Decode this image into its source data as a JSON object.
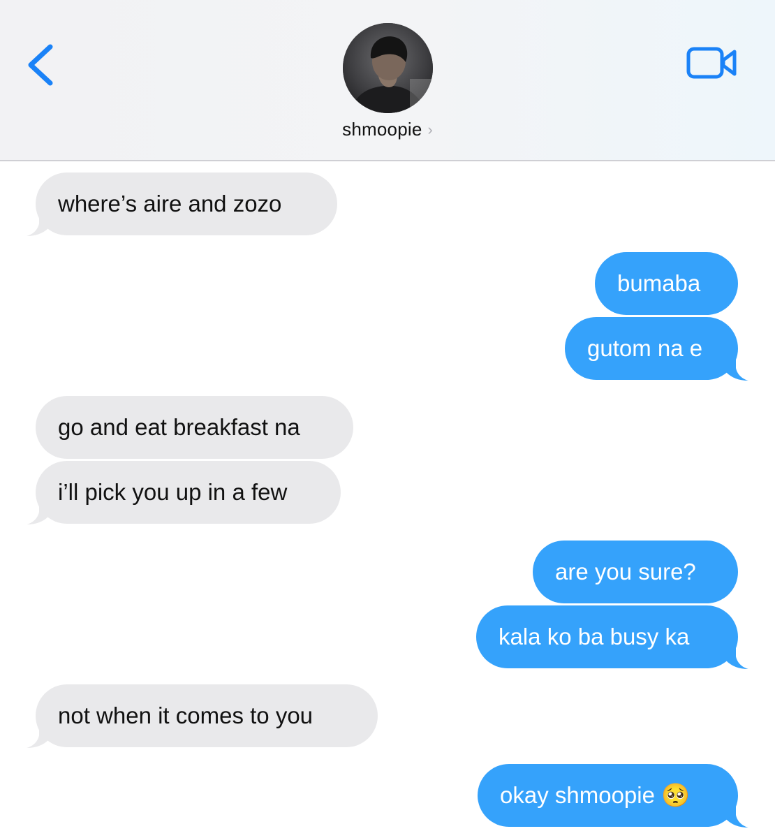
{
  "header": {
    "contact_name": "shmoopie",
    "chevron": "›",
    "back_icon": "chevron-left-icon",
    "video_icon": "video-camera-icon",
    "accent_color": "#1a82f7"
  },
  "colors": {
    "received_bubble": "#e9e9eb",
    "sent_bubble": "#35a2fb"
  },
  "messages": [
    {
      "direction": "received",
      "text": "where’s aire and zozo"
    },
    {
      "direction": "sent",
      "text": "bumaba"
    },
    {
      "direction": "sent",
      "text": "gutom na e"
    },
    {
      "direction": "received",
      "text": "go and eat breakfast na"
    },
    {
      "direction": "received",
      "text": "i’ll pick you up in a few"
    },
    {
      "direction": "sent",
      "text": "are you sure?"
    },
    {
      "direction": "sent",
      "text": "kala ko ba busy ka"
    },
    {
      "direction": "received",
      "text": "not when it comes to you"
    },
    {
      "direction": "sent",
      "text": "okay shmoopie 🥺"
    }
  ]
}
